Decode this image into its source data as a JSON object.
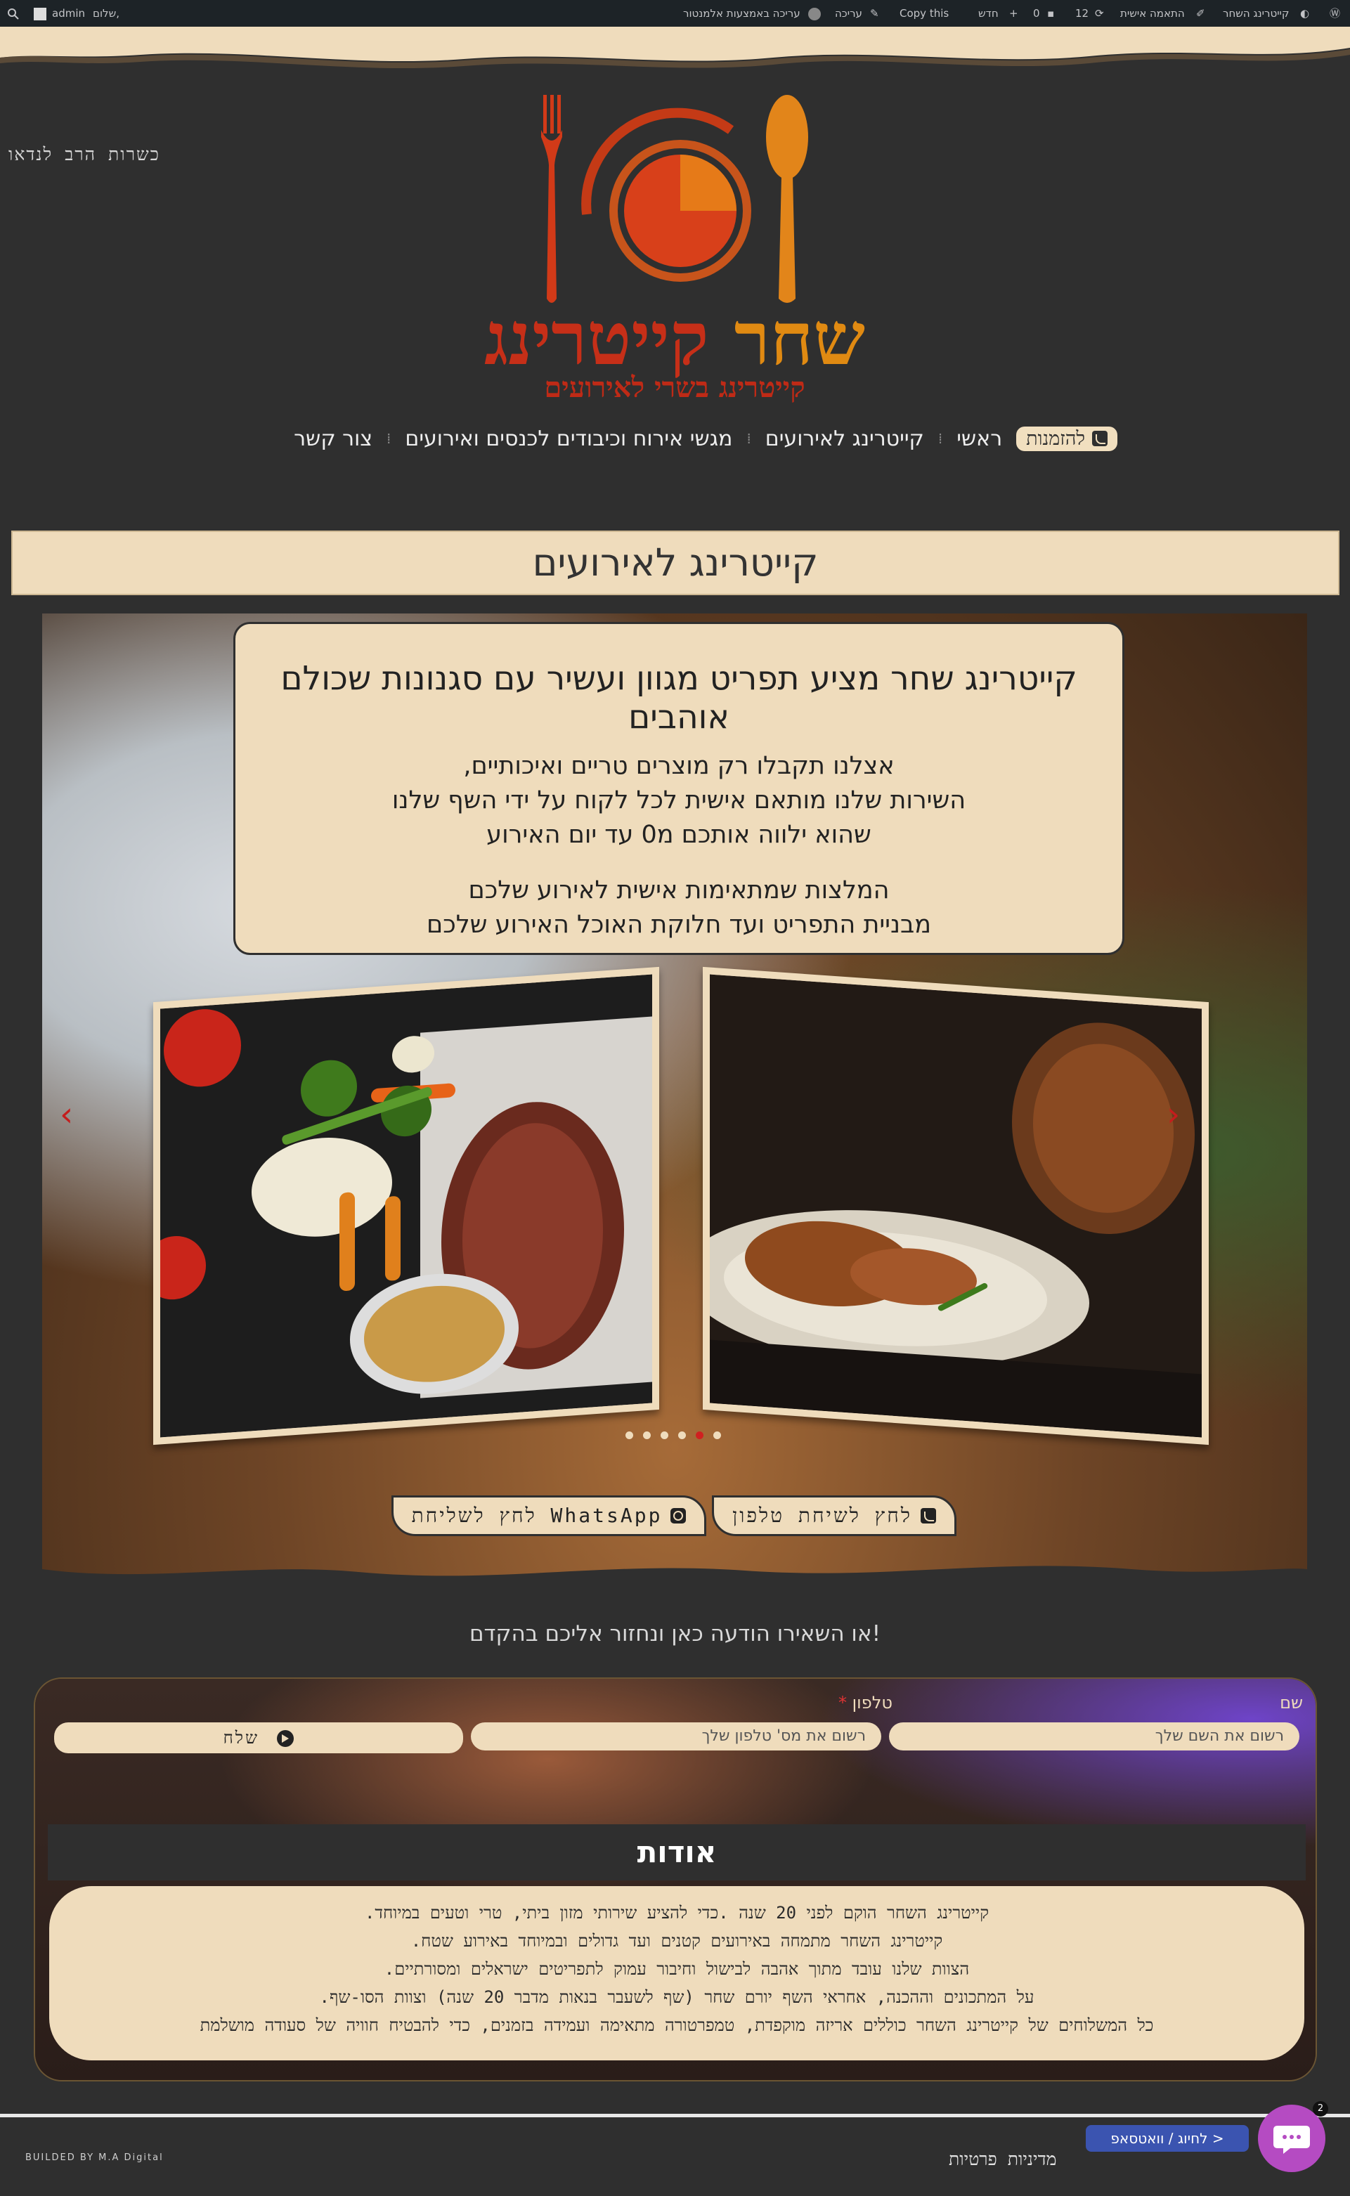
{
  "admin_bar": {
    "site_name": "קייטרינג השחר",
    "customize": "התאמה אישית",
    "updates_count": "12",
    "comments_count": "0",
    "new": "חדש",
    "copy": "Copy this",
    "edit": "עריכה",
    "edit_elementor": "עריכה באמצעות אלמנטור",
    "greeting": "שלום,",
    "user": "admin"
  },
  "header": {
    "kosher": "כשרות הרב לנדאו",
    "brand_word1": "קייטרינג",
    "brand_word2": "שחר",
    "brand_sub": "קייטרינג בשרי לאירועים"
  },
  "nav": {
    "items": [
      "ראשי",
      "קייטרינג לאירועים",
      "מגשי אירוח וכיבודים לכנסים ואירועים",
      "צור קשר"
    ],
    "cta": "להזמנות"
  },
  "page_title": "קייטרינג לאירועים",
  "hero": {
    "headline": "קייטרינג שחר  מציע תפריט מגוון ועשיר עם סגנונות שכולם אוהבים",
    "lines": [
      "אצלנו תקבלו רק מוצרים טריים ואיכותיים,",
      "השירות שלנו מותאם אישית לכל לקוח על ידי השף שלנו",
      "שהוא ילווה אותכם מ0 עד יום האירוע"
    ],
    "lines2": [
      "המלצות שמתאימות אישית לאירוע שלכם",
      "מבניית התפריט ועד חלוקת האוכל האירוע שלכם"
    ],
    "slides": 6,
    "active_slide": 5,
    "btn_phone": "לחץ לשיחת טלפון",
    "btn_whatsapp": "לחץ לשליחת WhatsApp"
  },
  "leave_msg": "או השאירו הודעה כאן ונחזור אליכם בהקדם!",
  "form": {
    "name_label": "שם",
    "name_placeholder": "רשום את השם שלך",
    "phone_label": "טלפון",
    "phone_required": "*",
    "phone_placeholder": "רשום את מס' טלפון שלך",
    "send": "שלח"
  },
  "about": {
    "title": "אודות",
    "lines": [
      "קייטרינג השחר הוקם לפני 20 שנה  .כדי להציע שירותי מזון ביתי, טרי וטעים במיוחד.",
      "קייטרינג השחר מתמחה באירועים קטנים ועד גדולים ובמיוחד באירוע שטח.",
      "הצוות שלנו עובד מתוך אהבה לבישול וחיבור עמוק לתפריטים ישראלים ומסורתיים.",
      "על המתכונים וההכנה, אחראי השף יורם  שחר  (שף לשעבר בנאות מדבר 20 שנה)  וצוות הסו-שף.",
      "כל המשלוחים של קייטרינג השחר  כוללים אריזה מוקפדת, טמפרטורה מתאימה ועמידה בזמנים, כדי להבטיח חוויה של סעודה מושלמת"
    ]
  },
  "footer": {
    "builded": "BUILDED BY M.A Digital",
    "privacy": "מדיניות פרטיות",
    "chat_pill": "לחיוג / וואטסאפ  >",
    "chat_badge": "2"
  },
  "colors": {
    "background": "#2f2f2f",
    "cream": "#efdcbc",
    "brand_red": "#c62f18",
    "brand_orange": "#e08a12"
  }
}
